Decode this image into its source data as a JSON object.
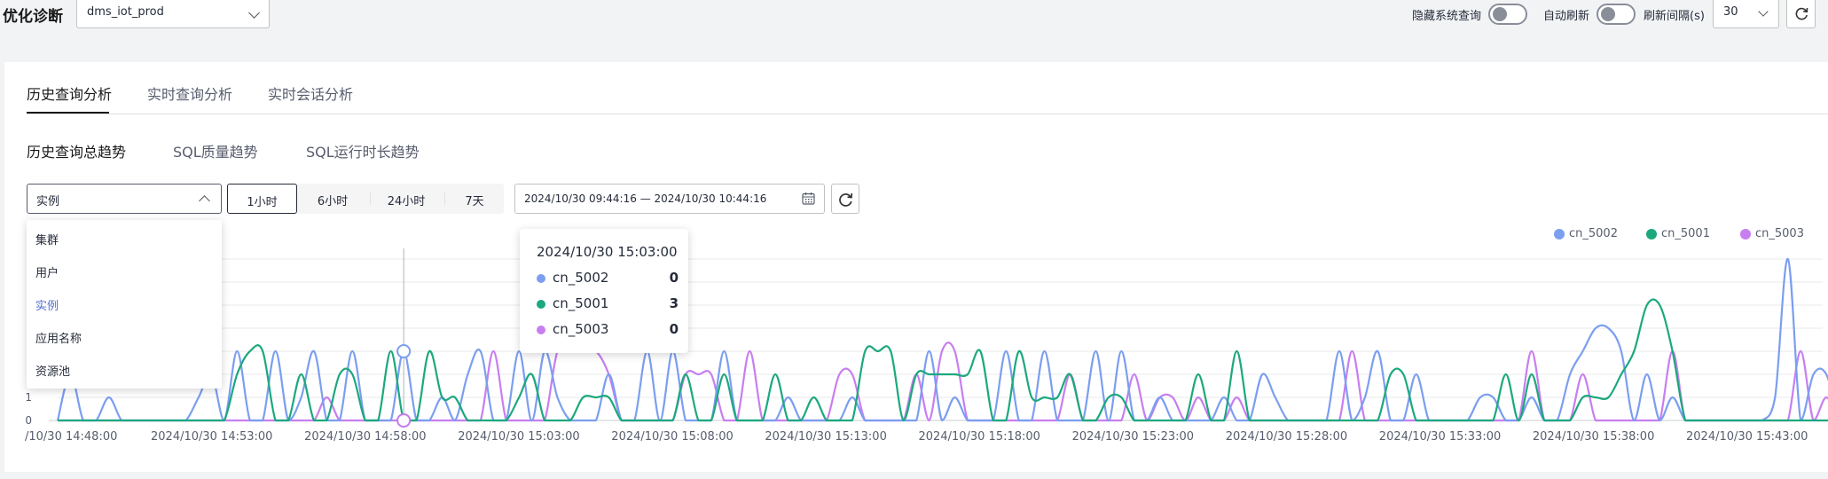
{
  "header": {
    "title": "优化诊断",
    "database": "dms_iot_prod",
    "hide_system_query_label": "隐藏系统查询",
    "auto_refresh_label": "自动刷新",
    "refresh_interval_label": "刷新间隔(s)",
    "refresh_interval_value": "30"
  },
  "main_tabs": [
    "历史查询分析",
    "实时查询分析",
    "实时会话分析"
  ],
  "sub_tabs": [
    "历史查询总趋势",
    "SQL质量趋势",
    "SQL运行时长趋势"
  ],
  "filter": {
    "dimension_value": "实例",
    "dimension_options": [
      "集群",
      "用户",
      "实例",
      "应用名称",
      "资源池"
    ],
    "time_ranges": [
      "1小时",
      "6小时",
      "24小时",
      "7天"
    ],
    "active_time_range": "1小时",
    "date_range": "2024/10/30 09:44:16 — 2024/10/30 10:44:16"
  },
  "tooltip": {
    "title": "2024/10/30 15:03:00",
    "rows": [
      {
        "name": "cn_5002",
        "value": "0"
      },
      {
        "name": "cn_5001",
        "value": "3"
      },
      {
        "name": "cn_5003",
        "value": "0"
      }
    ]
  },
  "colors": {
    "cn_5002": "#7b9ef0",
    "cn_5001": "#1ca87e",
    "cn_5003": "#c87ef0"
  },
  "chart_data": {
    "type": "line",
    "x_tick_labels": [
      "/10/30 14:48:00",
      "2024/10/30 14:53:00",
      "2024/10/30 14:58:00",
      "2024/10/30 15:03:00",
      "2024/10/30 15:08:00",
      "2024/10/30 15:13:00",
      "2024/10/30 15:18:00",
      "2024/10/30 15:23:00",
      "2024/10/30 15:28:00",
      "2024/10/30 15:33:00",
      "2024/10/30 15:38:00",
      "2024/10/30 15:43:00"
    ],
    "y_tick_labels": [
      "0",
      "1"
    ],
    "x_start": "2024/10/30 14:47:00",
    "x_step": "30s",
    "smooth": true,
    "legend": [
      "cn_5002",
      "cn_5001",
      "cn_5003"
    ],
    "legend_position": "top-right",
    "series": [
      {
        "name": "cn_5002",
        "values": [
          0,
          2,
          0,
          0,
          1,
          0,
          0,
          0,
          0,
          0,
          0,
          1,
          2,
          0,
          3,
          0,
          0,
          3,
          0,
          1,
          3,
          0,
          0,
          3,
          0,
          0,
          0,
          3,
          0,
          0,
          1,
          0,
          2,
          3,
          0,
          0,
          3,
          0,
          3,
          1,
          0,
          0,
          0,
          2,
          0,
          0,
          3,
          0,
          3,
          0,
          0,
          0,
          3,
          0,
          0,
          0,
          0,
          1,
          0,
          0,
          0,
          0,
          1,
          0,
          0,
          0,
          0,
          0,
          3,
          0,
          1,
          0,
          0,
          0,
          3,
          0,
          0,
          3,
          0,
          0,
          0,
          3,
          0,
          3,
          0,
          0,
          1,
          0,
          0,
          0,
          0,
          1,
          0,
          0,
          2,
          1,
          0,
          0,
          0,
          0,
          3,
          0,
          1,
          3,
          0,
          0,
          2,
          0,
          0,
          0,
          0,
          1,
          1,
          0,
          0,
          1,
          0,
          0,
          2,
          3,
          4,
          4,
          3,
          0,
          2,
          0,
          1,
          0,
          0,
          0,
          0,
          0,
          0,
          0,
          1,
          7,
          0,
          2,
          2,
          0
        ]
      },
      {
        "name": "cn_5001",
        "values": [
          0,
          0,
          0,
          0,
          0,
          0,
          0,
          0,
          0,
          0,
          0,
          0,
          0,
          0,
          2,
          3,
          3,
          0,
          0,
          2,
          0,
          0,
          2,
          2,
          0,
          0,
          3,
          0,
          0,
          3,
          1,
          1,
          0,
          0,
          0,
          0,
          1,
          2,
          0,
          0,
          0,
          1,
          1,
          1,
          0,
          0,
          0,
          0,
          0,
          2,
          0,
          0,
          2,
          0,
          0,
          0,
          2,
          0,
          0,
          1,
          0,
          0,
          0,
          3,
          3,
          3,
          0,
          2,
          2,
          2,
          2,
          2,
          3,
          0,
          0,
          3,
          1,
          1,
          1,
          2,
          0,
          0,
          1,
          1,
          0,
          0,
          0,
          0,
          0,
          2,
          0,
          0,
          3,
          0,
          0,
          0,
          0,
          0,
          0,
          0,
          0,
          0,
          0,
          0,
          2,
          2,
          0,
          0,
          0,
          0,
          0,
          0,
          0,
          2,
          0,
          2,
          0,
          0,
          0,
          1,
          1,
          1,
          2,
          3,
          5,
          5,
          3,
          0,
          0,
          0,
          0,
          0,
          0,
          0,
          0,
          0,
          0,
          0,
          0,
          0
        ]
      },
      {
        "name": "cn_5003",
        "values": [
          0,
          0,
          0,
          0,
          0,
          0,
          0,
          0,
          0,
          0,
          0,
          0,
          0,
          0,
          0,
          0,
          0,
          0,
          0,
          0,
          0,
          1,
          0,
          0,
          0,
          0,
          0,
          0,
          0,
          0,
          0,
          0,
          0,
          0,
          3,
          0,
          0,
          0,
          0,
          3,
          3,
          3,
          3,
          2,
          0,
          0,
          0,
          0,
          0,
          2,
          2,
          2,
          0,
          0,
          3,
          0,
          0,
          0,
          0,
          0,
          0,
          2,
          2,
          0,
          0,
          0,
          0,
          2,
          0,
          3,
          3,
          0,
          0,
          0,
          0,
          0,
          0,
          0,
          0,
          2,
          0,
          0,
          0,
          0,
          2,
          0,
          1,
          1,
          0,
          1,
          0,
          0,
          1,
          0,
          0,
          0,
          0,
          0,
          0,
          0,
          0,
          3,
          0,
          0,
          0,
          0,
          0,
          0,
          0,
          0,
          0,
          0,
          0,
          0,
          0,
          3,
          0,
          0,
          0,
          2,
          0,
          0,
          0,
          0,
          0,
          0,
          3,
          0,
          0,
          0,
          0,
          0,
          0,
          0,
          0,
          0,
          3,
          0,
          1,
          0
        ]
      }
    ],
    "hover_x": "2024/10/30 15:03:00"
  }
}
